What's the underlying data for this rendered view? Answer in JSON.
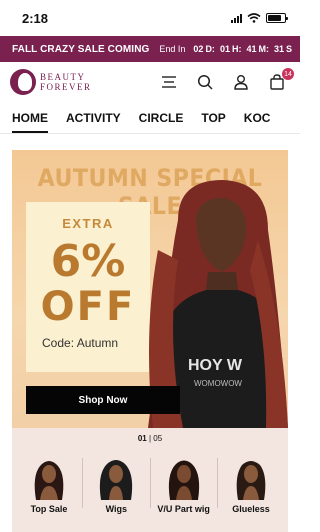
{
  "status_bar": {
    "time": "2:18"
  },
  "promo_bar": {
    "text": "FALL CRAZY SALE COMING",
    "ends_label": "End In",
    "days": "02",
    "days_unit": "D:",
    "hours": "01",
    "hours_unit": "H:",
    "minutes": "41",
    "minutes_unit": "M:",
    "seconds": "31",
    "seconds_unit": "S"
  },
  "header": {
    "logo_line1": "BEAUTY",
    "logo_line2": "FOREVER",
    "cart_count": "14"
  },
  "nav": {
    "tabs": [
      {
        "label": "HOME"
      },
      {
        "label": "ACTIVITY"
      },
      {
        "label": "CIRCLE"
      },
      {
        "label": "TOP"
      },
      {
        "label": "KOC"
      }
    ]
  },
  "banner": {
    "title": "AUTUMN SPECIAL SALE",
    "extra": "EXTRA",
    "percent": "6%",
    "off": "OFF",
    "code": "Code: Autumn",
    "shop_label": "Shop Now"
  },
  "categories": {
    "pager_current": "01",
    "pager_sep": "|",
    "pager_total": "05",
    "items": [
      {
        "label": "Top Sale"
      },
      {
        "label": "Wigs"
      },
      {
        "label": "V/U Part wig"
      },
      {
        "label": "Glueless"
      }
    ]
  },
  "colors": {
    "brand": "#7a2150",
    "banner_bg": "#f3c894",
    "offer_text": "#b97a30"
  }
}
